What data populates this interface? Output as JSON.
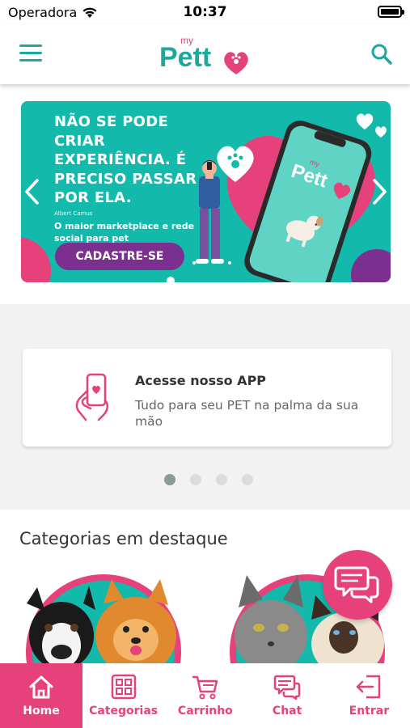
{
  "status_bar": {
    "carrier": "Operadora",
    "time": "10:37"
  },
  "header": {
    "logo_small": "my",
    "logo_text": "Pett"
  },
  "banner": {
    "heading": "NÃO SE PODE CRIAR EXPERIÊNCIA. É PRECISO PASSAR POR ELA.",
    "author": "Albert Camus",
    "subtitle": "O maior marketplace e rede social para pet",
    "cta_label": "CADASTRE-SE",
    "phone_logo_small": "my",
    "phone_logo": "Pett"
  },
  "app_card": {
    "title": "Acesse nosso APP",
    "text": "Tudo para seu PET na palma da sua mão"
  },
  "carousel": {
    "pages": 4,
    "active_index": 0
  },
  "categories": {
    "title": "Categorias em destaque",
    "items": [
      {
        "name": "dogs",
        "icon": "dogs-photo"
      },
      {
        "name": "cats",
        "icon": "cats-photo"
      }
    ]
  },
  "bottom_nav": {
    "items": [
      {
        "label": "Home",
        "icon": "home-icon",
        "active": true
      },
      {
        "label": "Categorias",
        "icon": "grid-icon",
        "active": false
      },
      {
        "label": "Carrinho",
        "icon": "cart-icon",
        "active": false
      },
      {
        "label": "Chat",
        "icon": "chat-icon",
        "active": false
      },
      {
        "label": "Entrar",
        "icon": "login-icon",
        "active": false
      }
    ]
  },
  "colors": {
    "brand_teal": "#1aa99b",
    "banner_teal": "#13b9ab",
    "brand_pink": "#e7417c",
    "cta_purple": "#7b2f8f"
  }
}
